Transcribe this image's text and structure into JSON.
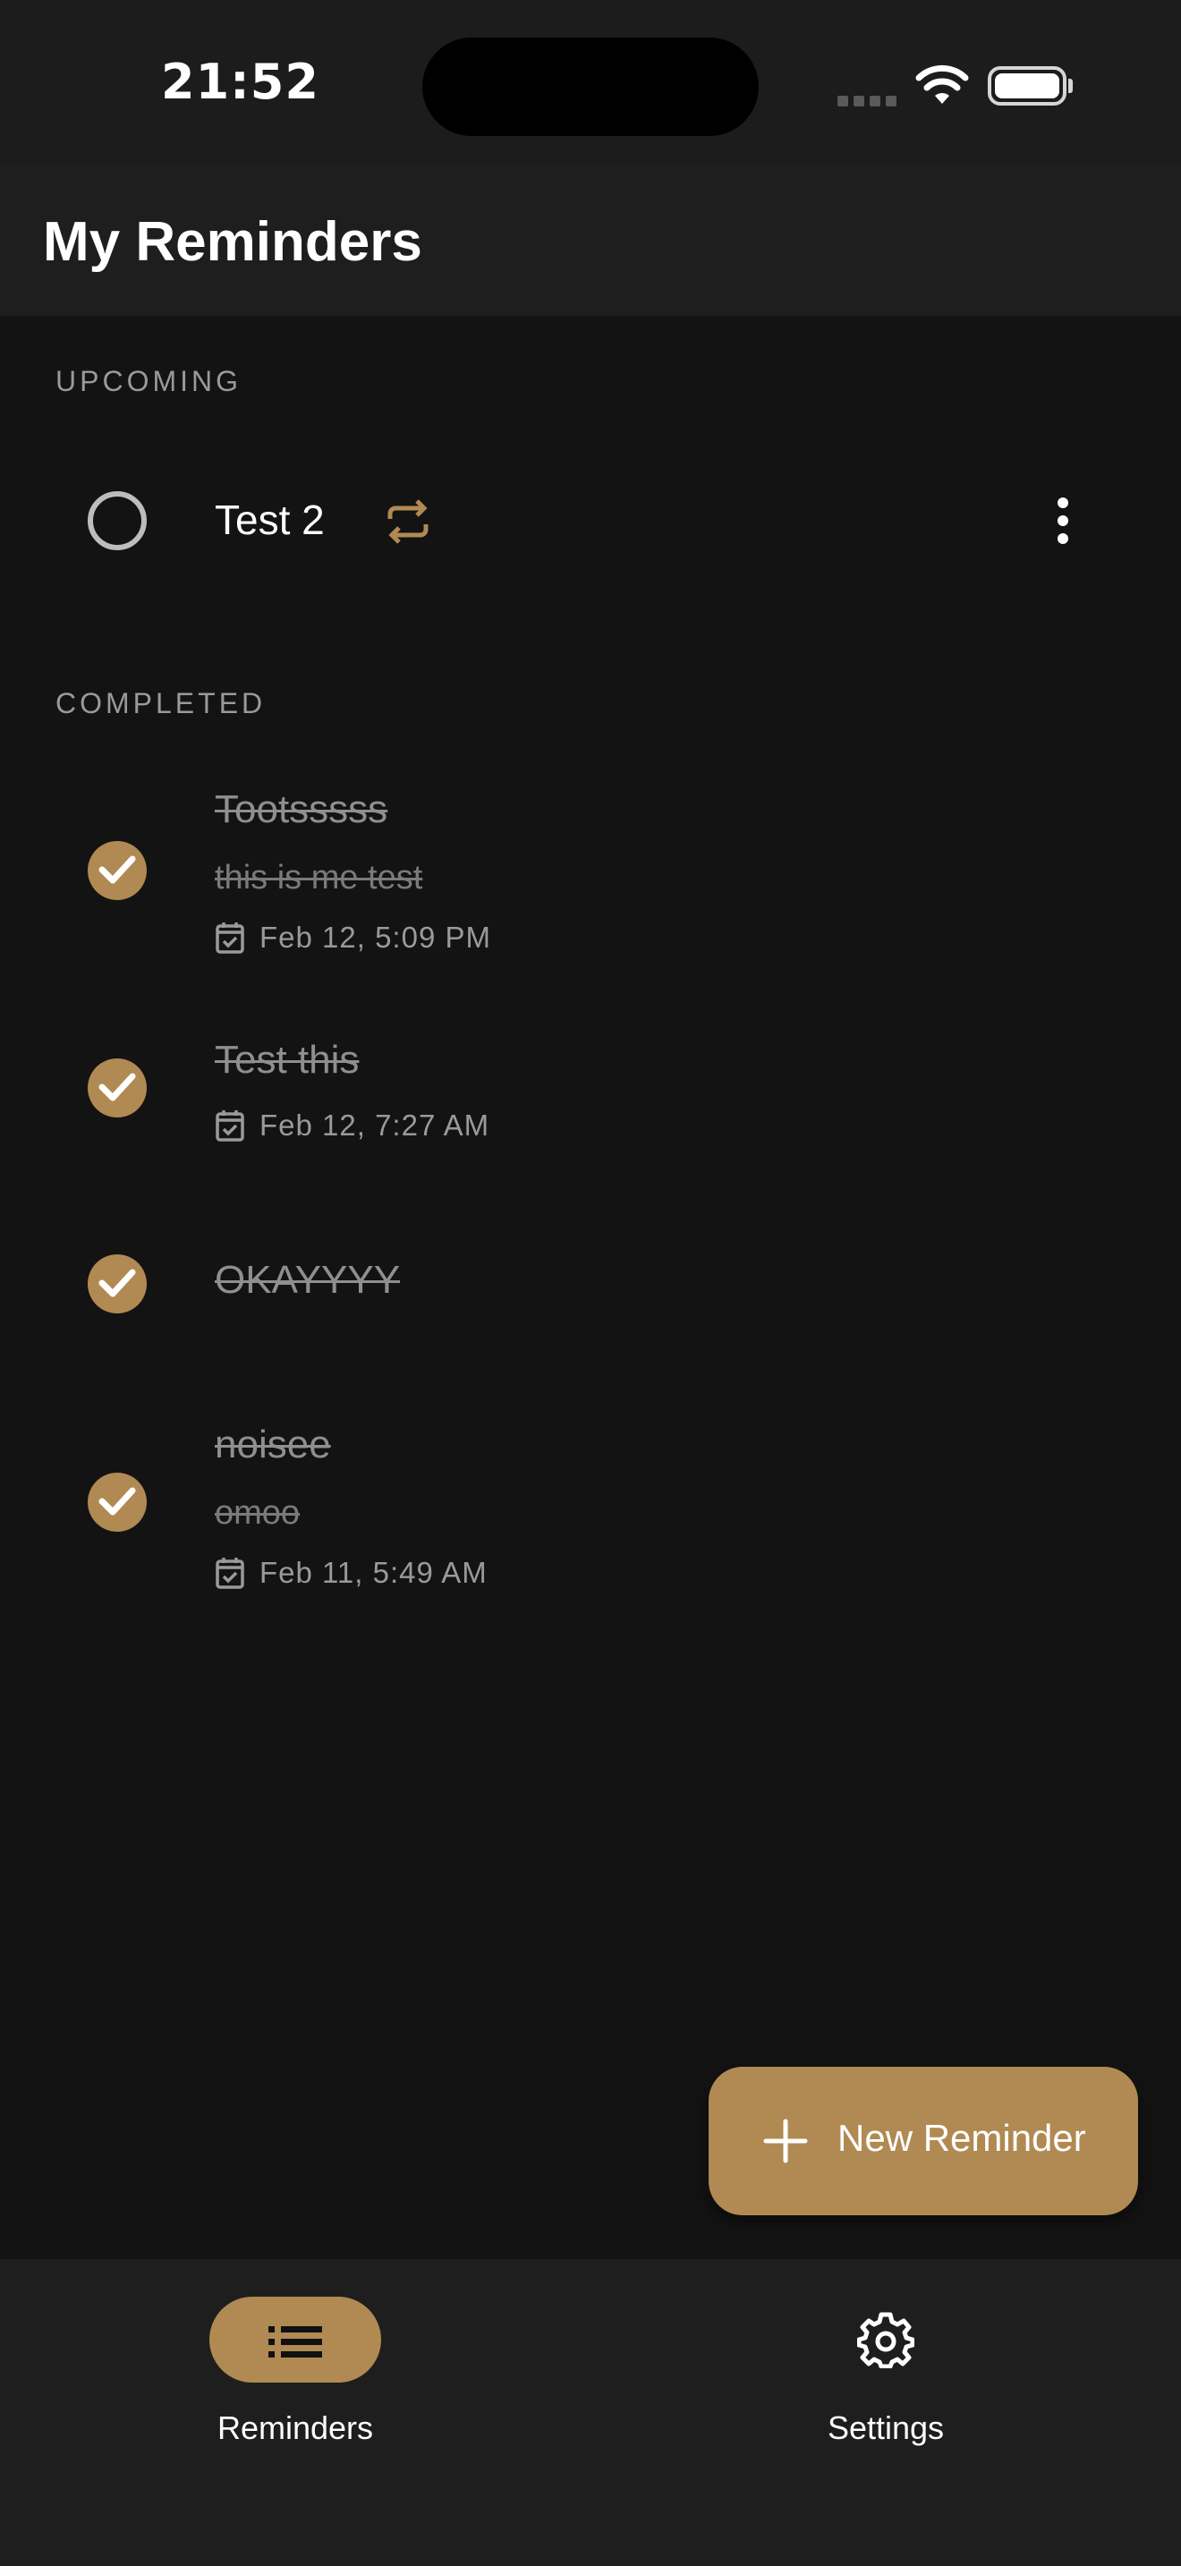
{
  "status_bar": {
    "time": "21:52"
  },
  "header": {
    "title": "My Reminders"
  },
  "sections": {
    "upcoming": {
      "label": "UPCOMING",
      "items": [
        {
          "title": "Test 2",
          "repeating": true
        }
      ]
    },
    "completed": {
      "label": "COMPLETED",
      "items": [
        {
          "title": "Tootsssss",
          "note": "this is me test",
          "date": "Feb 12, 5:09 PM"
        },
        {
          "title": "Test this",
          "date": "Feb 12, 7:27 AM"
        },
        {
          "title": "OKAYYYY"
        },
        {
          "title": "noisee",
          "note": "omoo",
          "date": "Feb 11, 5:49 AM"
        }
      ]
    }
  },
  "fab": {
    "label": "New Reminder"
  },
  "bottom_nav": {
    "items": [
      {
        "label": "Reminders",
        "icon": "list-icon",
        "active": true
      },
      {
        "label": "Settings",
        "icon": "gear-icon",
        "active": false
      }
    ]
  },
  "colors": {
    "accent": "#b08a52",
    "background": "#131313",
    "surface": "#1e1e1e"
  }
}
